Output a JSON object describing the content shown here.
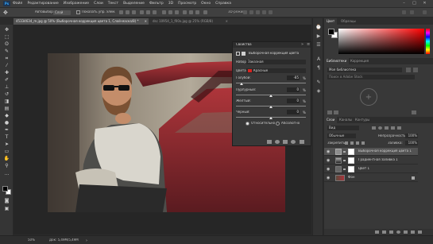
{
  "menubar": {
    "logo": "Ps",
    "items": [
      "Файл",
      "Редактирование",
      "Изображение",
      "Слои",
      "Текст",
      "Выделение",
      "Фильтр",
      "3D",
      "Просмотр",
      "Окно",
      "Справка"
    ],
    "window_buttons": [
      "–",
      "□",
      "✕"
    ]
  },
  "options_bar": {
    "tool_icon": "move-icon",
    "autoselect_label": "Автовыбор:",
    "autoselect_value": "Слой",
    "show_controls_label": "Показать упр. элем.",
    "mode_label": "3D-режим:"
  },
  "document_tabs": [
    {
      "label": "45334634_m.jpg @ 50% (Выборочная коррекция цвета 1, Слой-маска/8) *",
      "active": true,
      "close": "×"
    },
    {
      "label": "dsc 10954_1_f00x.jpg @ 25% (RGB/8)",
      "active": false,
      "close": "×"
    }
  ],
  "properties": {
    "title": "Свойства",
    "adjustment_name": "Выборочная коррекция цвета",
    "preset_label": "Набор:",
    "preset_value": "Заказная",
    "colors_label": "Цвета:",
    "colors_value": "Красные",
    "colors_swatch": "#d8231f",
    "sliders": [
      {
        "label": "Голубой:",
        "value": "-85",
        "unit": "%",
        "level": -85
      },
      {
        "label": "Пурпурный:",
        "value": "0",
        "unit": "%",
        "level": 0
      },
      {
        "label": "Желтый:",
        "value": "0",
        "unit": "%",
        "level": 0
      },
      {
        "label": "Черный:",
        "value": "0",
        "unit": "%",
        "level": 0
      }
    ],
    "method_relative": "Относительно",
    "method_absolute": "Абсолютно"
  },
  "color_panel": {
    "tabs": [
      "Цвет",
      "Образцы"
    ],
    "fg_color": "#000000",
    "bg_color": "#ffffff"
  },
  "library_panel": {
    "tabs": [
      "Библиотеки",
      "Коррекция"
    ],
    "library_value": "Моя библиотека",
    "search_placeholder": "Поиск в Adobe Stock"
  },
  "layers_panel": {
    "tabs": [
      "Слои",
      "Каналы",
      "Контуры"
    ],
    "filter_label": "Вид",
    "blend_mode": "Обычные",
    "opacity_label": "Непрозрачность:",
    "opacity_value": "100%",
    "lock_label": "Закрепить:",
    "fill_label": "Заливка:",
    "fill_value": "100%",
    "layers": [
      {
        "name": "Выборочная коррекция цвета 1",
        "type": "adjustment",
        "selected": true
      },
      {
        "name": "Градиентная заливка 1",
        "type": "gradient",
        "selected": false
      },
      {
        "name": "Цвет 1",
        "type": "solid",
        "selected": false
      },
      {
        "name": "Фон",
        "type": "photo",
        "selected": false
      }
    ]
  },
  "statusbar": {
    "zoom": "50%",
    "doc_info": "Док: 5,49M/5,49M"
  }
}
